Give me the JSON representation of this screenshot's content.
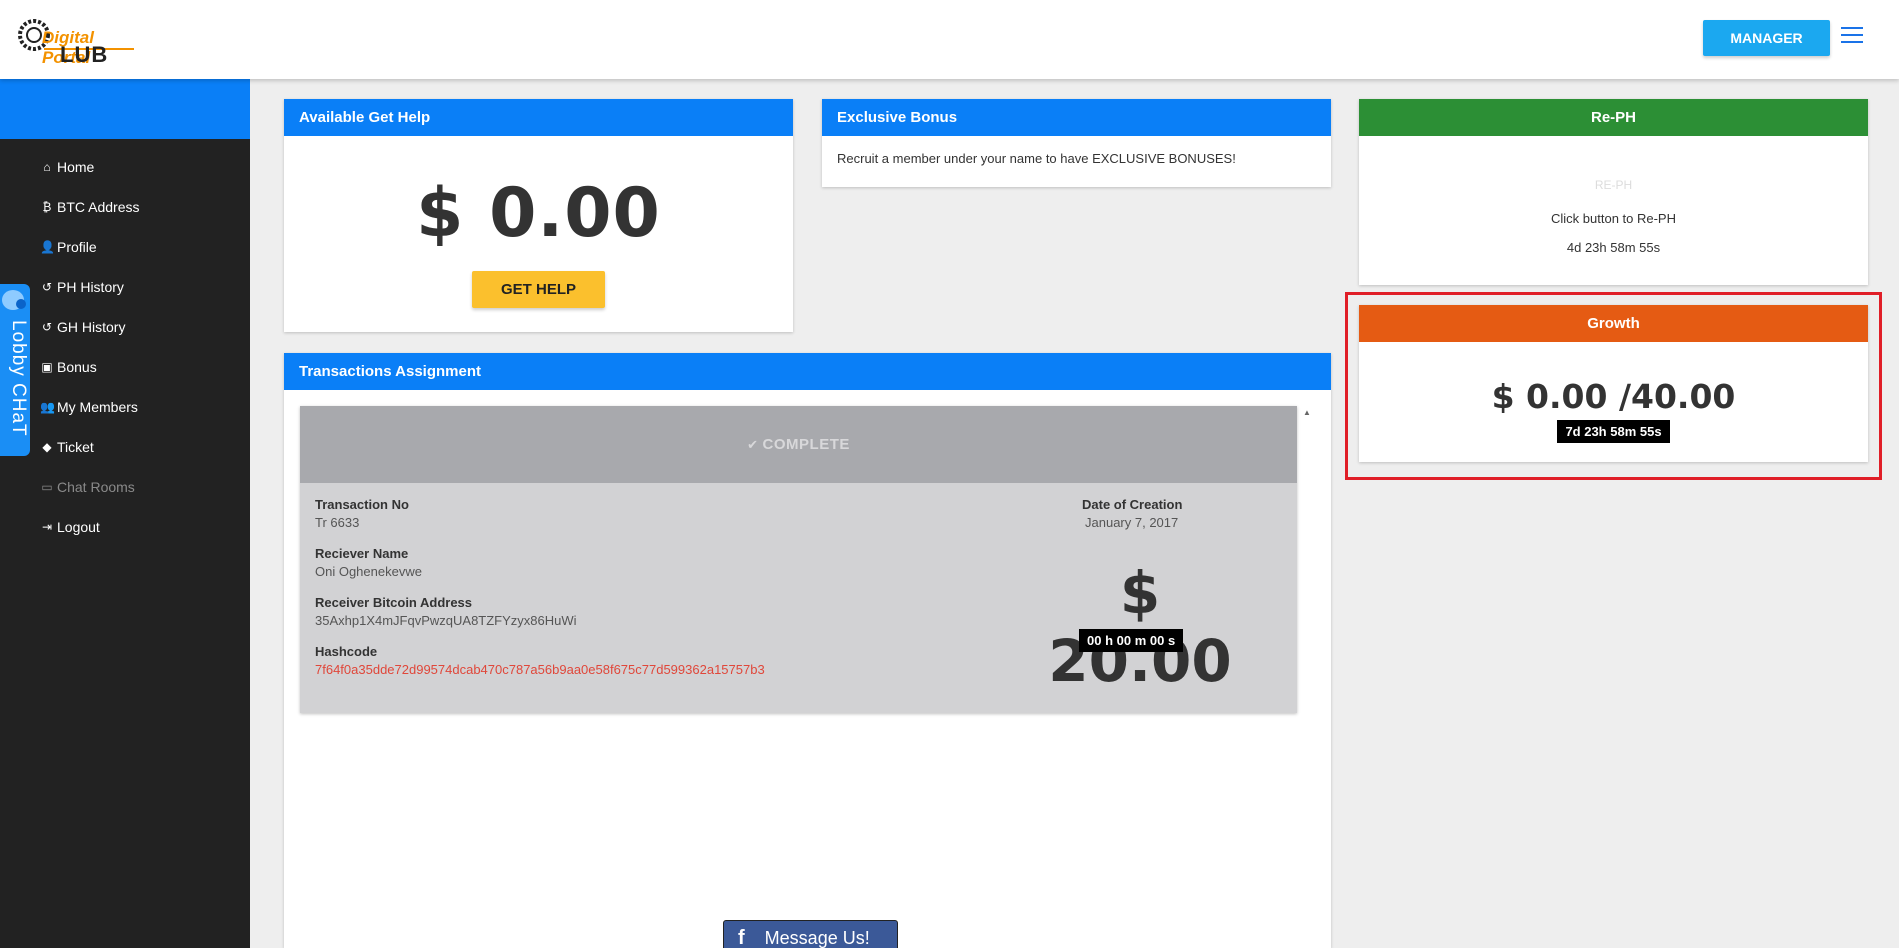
{
  "header": {
    "logo_line1": "Digital Portal",
    "logo_line2": "LUB",
    "manager_label": "MANAGER"
  },
  "sidebar": {
    "items": [
      {
        "label": "Home",
        "icon": "home-icon",
        "glyph": "⌂"
      },
      {
        "label": "BTC Address",
        "icon": "bitcoin-icon",
        "glyph": "₿"
      },
      {
        "label": "Profile",
        "icon": "user-icon",
        "glyph": "👤"
      },
      {
        "label": "PH History",
        "icon": "history-icon",
        "glyph": "↺"
      },
      {
        "label": "GH History",
        "icon": "history-icon",
        "glyph": "↺"
      },
      {
        "label": "Bonus",
        "icon": "money-icon",
        "glyph": "▣"
      },
      {
        "label": "My Members",
        "icon": "users-icon",
        "glyph": "👥"
      },
      {
        "label": "Ticket",
        "icon": "tag-icon",
        "glyph": "◆"
      },
      {
        "label": "Chat Rooms",
        "icon": "inbox-icon",
        "glyph": "▭"
      },
      {
        "label": "Logout",
        "icon": "sign-out-icon",
        "glyph": "⇥"
      }
    ]
  },
  "lobby_chat": {
    "label": "Lobby CHaT"
  },
  "get_help": {
    "title": "Available Get Help",
    "amount": "$ 0.00",
    "button_label": "GET HELP"
  },
  "bonus": {
    "title": "Exclusive Bonus",
    "text": "Recruit a member under your name to have EXCLUSIVE BONUSES!"
  },
  "reph": {
    "title": "Re-PH",
    "button_label": "RE-PH",
    "instruction": "Click button to Re-PH",
    "countdown": "4d 23h 58m 55s"
  },
  "growth": {
    "title": "Growth",
    "amount": "$ 0.00 /40.00",
    "countdown": "7d 23h 58m 55s"
  },
  "transactions": {
    "title": "Transactions Assignment",
    "status": "COMPLETE",
    "fields": {
      "transaction_no_label": "Transaction No",
      "transaction_no": "Tr 6633",
      "receiver_name_label": "Reciever Name",
      "receiver_name": "Oni Oghenekevwe",
      "bitcoin_address_label": "Receiver Bitcoin Address",
      "bitcoin_address": "35Axhp1X4mJFqvPwzqUA8TZFYzyx86HuWi",
      "hashcode_label": "Hashcode",
      "hashcode": "7f64f0a35dde72d99574dcab470c787a56b9aa0e58f675c77d599362a15757b3",
      "date_label": "Date of Creation",
      "date": "January 7, 2017"
    },
    "amount": "$ 20.00",
    "timer": "00 h 00 m 00 s"
  },
  "messenger": {
    "label": "Message Us!"
  },
  "colors": {
    "primary_blue": "#0a7ff7",
    "sidebar_dark": "#222222",
    "reph_green": "#2c8f35",
    "growth_orange": "#e55b13",
    "highlight_red": "#e01e27",
    "button_yellow": "#fbc02d",
    "manager_blue": "#1ba8f0"
  }
}
